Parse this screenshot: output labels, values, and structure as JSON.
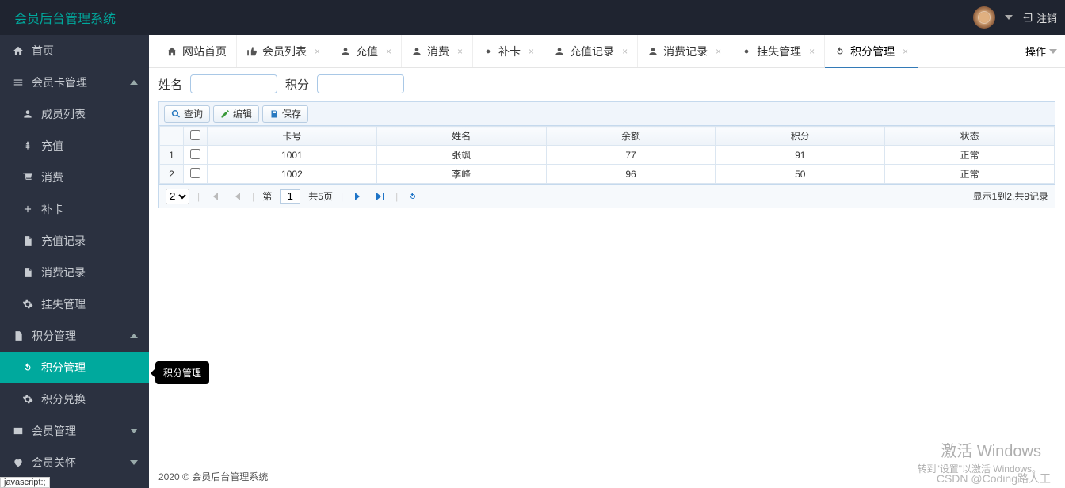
{
  "brand": "会员后台管理系统",
  "top": {
    "logout": "注销"
  },
  "sidebar": {
    "home": "首页",
    "card_group": "会员卡管理",
    "members": "成员列表",
    "recharge": "充值",
    "consume": "消费",
    "replace": "补卡",
    "recharge_log": "充值记录",
    "consume_log": "消费记录",
    "loss": "挂失管理",
    "points_group": "积分管理",
    "points_mgmt": "积分管理",
    "points_exchange": "积分兑换",
    "member_mgmt": "会员管理",
    "care": "会员关怀"
  },
  "tabs": {
    "t0": "网站首页",
    "t1": "会员列表",
    "t2": "充值",
    "t3": "消费",
    "t4": "补卡",
    "t5": "充值记录",
    "t6": "消费记录",
    "t7": "挂失管理",
    "t8": "积分管理",
    "ops": "操作"
  },
  "filters": {
    "name_label": "姓名",
    "points_label": "积分"
  },
  "toolbar": {
    "query": "查询",
    "edit": "编辑",
    "save": "保存"
  },
  "grid": {
    "cols": {
      "card": "卡号",
      "name": "姓名",
      "balance": "余额",
      "points": "积分",
      "status": "状态"
    },
    "rows": [
      {
        "n": "1",
        "card": "1001",
        "name": "张飒",
        "balance": "77",
        "points": "91",
        "status": "正常"
      },
      {
        "n": "2",
        "card": "1002",
        "name": "李峰",
        "balance": "96",
        "points": "50",
        "status": "正常"
      }
    ]
  },
  "pager": {
    "size": "2",
    "page_prefix": "第",
    "page": "1",
    "total_pages": "共5页",
    "info": "显示1到2,共9记录"
  },
  "tooltip": "积分管理",
  "footer": "2020 © 会员后台管理系统",
  "wm1": "激活 Windows",
  "wm2": "转到\"设置\"以激活 Windows。",
  "csdn": "CSDN @Coding路人王",
  "status": "javascript:;"
}
